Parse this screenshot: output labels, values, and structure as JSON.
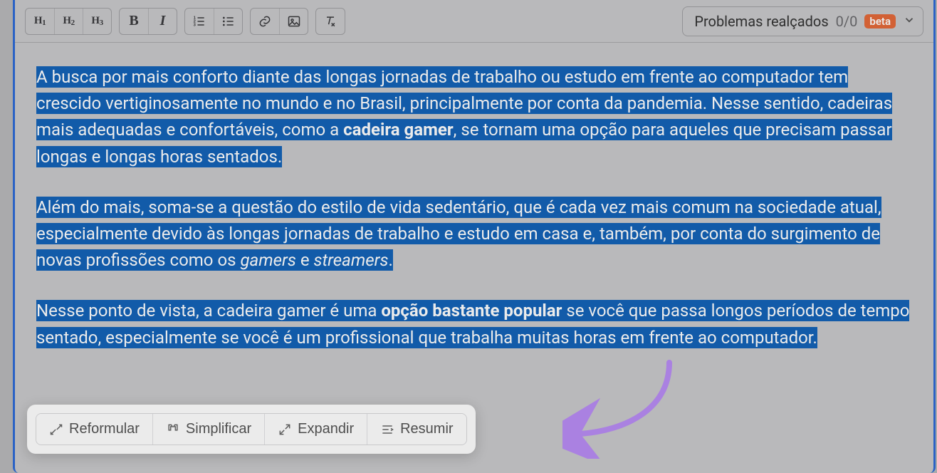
{
  "toolbar": {
    "headings": [
      "H1",
      "H2",
      "H3"
    ],
    "problems_label": "Problemas realçados",
    "problems_count": "0/0",
    "beta_label": "beta"
  },
  "content": {
    "paragraphs": [
      {
        "segments": [
          {
            "text": "A busca por mais conforto diante das longas jornadas de trabalho ou estudo em frente ao computador tem crescido vertiginosamente no mundo e no Brasil, principalmente por conta da pandemia. Nesse sentido, cadeiras mais adequadas e confortáveis, como a ",
            "b": false,
            "i": false
          },
          {
            "text": "cadeira gamer",
            "b": true,
            "i": false
          },
          {
            "text": ", se tornam uma opção para aqueles que precisam passar longas e longas horas sentados.",
            "b": false,
            "i": false
          }
        ]
      },
      {
        "segments": [
          {
            "text": "Além do mais, soma-se a questão do estilo de vida sedentário, que é cada vez mais comum na sociedade atual, especialmente devido às longas jornadas de trabalho e estudo em casa e, também, por conta do surgimento de novas profissões como os ",
            "b": false,
            "i": false
          },
          {
            "text": "gamers",
            "b": false,
            "i": true
          },
          {
            "text": " e ",
            "b": false,
            "i": false
          },
          {
            "text": "streamers",
            "b": false,
            "i": true
          },
          {
            "text": ".",
            "b": false,
            "i": false
          }
        ]
      },
      {
        "segments": [
          {
            "text": "Nesse ponto de vista, a cadeira gamer é uma ",
            "b": false,
            "i": false
          },
          {
            "text": "opção bastante popular",
            "b": true,
            "i": false
          },
          {
            "text": " se você que passa longos períodos de tempo sentado, especialmente se você é um profissional que trabalha muitas horas em frente ao computador.",
            "b": false,
            "i": false
          }
        ]
      }
    ]
  },
  "actions": {
    "reformulate": "Reformular",
    "simplify": "Simplificar",
    "expand": "Expandir",
    "summarize": "Resumir"
  },
  "colors": {
    "selection": "#1463b8",
    "frame_border": "#2e6bd6",
    "beta_badge": "#e46a3a",
    "arrow": "#b98cf5"
  }
}
